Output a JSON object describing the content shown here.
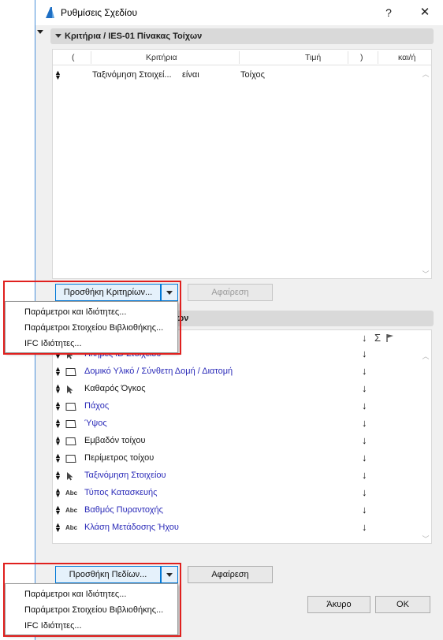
{
  "window": {
    "title": "Ρυθμίσεις Σχεδίου",
    "help": "?",
    "close": "✕"
  },
  "criteria_section": {
    "header": "Κριτήρια / IES-01 Πίνακας Τοίχων",
    "columns": {
      "open_paren": "(",
      "criteria": "Κριτήρια",
      "value": "Τιμή",
      "close_paren": ")",
      "and_or": "και/ή"
    },
    "row": {
      "criteria": "Ταξινόμηση Στοιχεί...",
      "operator": "είναι",
      "value": "Τοίχος"
    },
    "add_button": "Προσθήκη Κριτηρίων...",
    "remove_button": "Αφαίρεση"
  },
  "criteria_menu": {
    "items": [
      "Παράμετροι και Ιδιότητες...",
      "Παράμετροι Στοιχείου Βιβλιοθήκης...",
      "IFC Ιδιότητες..."
    ]
  },
  "fields_section": {
    "header_fragment": "ων",
    "col_sort": "↓",
    "col_sum": "Σ",
    "fields": [
      {
        "label": "Πλήρες ID Στοιχείου",
        "icon": "arrow-cursor-icon",
        "blue": true
      },
      {
        "label": "Δομικό Υλικό / Σύνθετη Δομή / Διατομή",
        "icon": "rectangle-icon",
        "blue": true
      },
      {
        "label": "Καθαρός Όγκος",
        "icon": "arrow-cursor-icon",
        "blue": false
      },
      {
        "label": "Πάχος",
        "icon": "rectangle-icon",
        "blue": true
      },
      {
        "label": "Ύψος",
        "icon": "rectangle-icon",
        "blue": true
      },
      {
        "label": "Εμβαδόν τοίχου",
        "icon": "rectangle-icon",
        "blue": false
      },
      {
        "label": "Περίμετρος τοίχου",
        "icon": "rectangle-icon",
        "blue": false
      },
      {
        "label": "Ταξινόμηση Στοιχείου",
        "icon": "arrow-cursor-icon",
        "blue": true
      },
      {
        "label": "Τύπος Κατασκευής",
        "icon": "abc-icon",
        "blue": true
      },
      {
        "label": "Βαθμός Πυραντοχής",
        "icon": "abc-icon",
        "blue": true
      },
      {
        "label": "Κλάση Μετάδοσης Ήχου",
        "icon": "abc-icon",
        "blue": true
      }
    ],
    "abc_text": "Abc",
    "sort_arrow": "↓",
    "add_button": "Προσθήκη Πεδίων...",
    "remove_button": "Αφαίρεση"
  },
  "fields_menu": {
    "items": [
      "Παράμετροι και Ιδιότητες...",
      "Παράμετροι Στοιχείου Βιβλιοθήκης...",
      "IFC Ιδιότητες..."
    ]
  },
  "footer": {
    "cancel": "Άκυρο",
    "ok": "ΟΚ"
  }
}
